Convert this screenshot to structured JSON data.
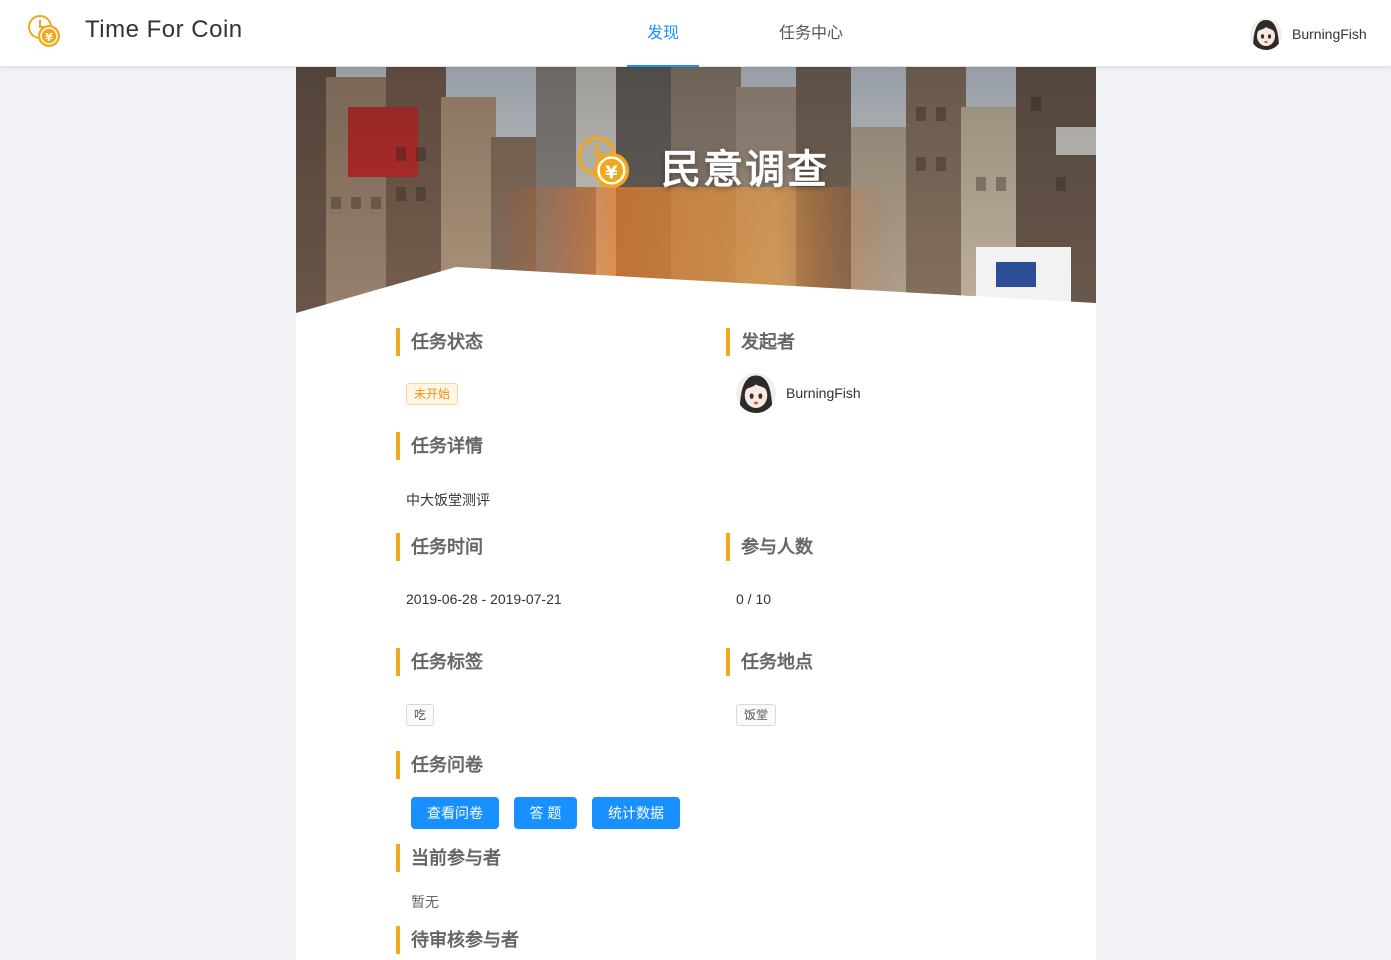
{
  "app": {
    "brand": "Time For Coin"
  },
  "nav": {
    "tabs": [
      {
        "label": "发现",
        "active": true
      },
      {
        "label": "任务中心",
        "active": false
      }
    ]
  },
  "user": {
    "name": "BurningFish"
  },
  "task": {
    "title": "民意调查",
    "status_heading": "任务状态",
    "status_value": "未开始",
    "creator_heading": "发起者",
    "creator_name": "BurningFish",
    "detail_heading": "任务详情",
    "detail_value": "中大饭堂测评",
    "time_heading": "任务时间",
    "time_value": "2019-06-28 - 2019-07-21",
    "participants_heading": "参与人数",
    "participants_value": "0 / 10",
    "tags_heading": "任务标签",
    "tag": "吃",
    "location_heading": "任务地点",
    "location": "饭堂",
    "survey_heading": "任务问卷",
    "buttons": {
      "view": "查看问卷",
      "answer": "答 题",
      "stats": "统计数据"
    },
    "current_heading": "当前参与者",
    "current_value": "暂无",
    "pending_heading": "待审核参与者"
  },
  "colors": {
    "accent": "#1890ff",
    "section_bar": "#f0a81c",
    "coin": "#f0a81c"
  },
  "icons": {
    "logo": "clock-coin-icon",
    "avatar": "anime-girl-avatar"
  }
}
